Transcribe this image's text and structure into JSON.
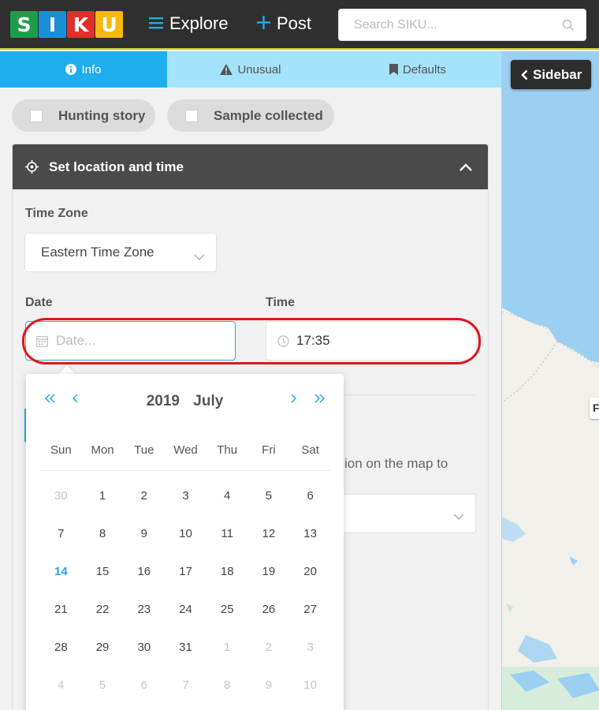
{
  "header": {
    "logo_letters": [
      {
        "letter": "S",
        "color": "#1d9d4a"
      },
      {
        "letter": "I",
        "color": "#1a8fd8"
      },
      {
        "letter": "K",
        "color": "#e0302b"
      },
      {
        "letter": "U",
        "color": "#f5b90f"
      }
    ],
    "explore_label": "Explore",
    "post_label": "Post",
    "search_placeholder": "Search SIKU..."
  },
  "tabs": [
    {
      "label": "Info",
      "icon": "info-icon",
      "active": true
    },
    {
      "label": "Unusual",
      "icon": "warning-icon",
      "active": false
    },
    {
      "label": "Defaults",
      "icon": "bookmark-icon",
      "active": false
    }
  ],
  "toggles": {
    "hunting_story": "Hunting story",
    "sample_collected": "Sample collected"
  },
  "location_section": {
    "title": "Set location and time",
    "timezone_label": "Time Zone",
    "timezone_value": "Eastern Time Zone",
    "date_label": "Date",
    "date_placeholder": "Date...",
    "time_label": "Time",
    "time_value": "17:35",
    "background_text": "ion on the map to"
  },
  "calendar": {
    "year": "2019",
    "month": "July",
    "weekdays": [
      "Sun",
      "Mon",
      "Tue",
      "Wed",
      "Thu",
      "Fri",
      "Sat"
    ],
    "days": [
      {
        "d": "30",
        "muted": true
      },
      {
        "d": "1"
      },
      {
        "d": "2"
      },
      {
        "d": "3"
      },
      {
        "d": "4"
      },
      {
        "d": "5"
      },
      {
        "d": "6"
      },
      {
        "d": "7"
      },
      {
        "d": "8"
      },
      {
        "d": "9"
      },
      {
        "d": "10"
      },
      {
        "d": "11"
      },
      {
        "d": "12"
      },
      {
        "d": "13"
      },
      {
        "d": "14",
        "today": true
      },
      {
        "d": "15"
      },
      {
        "d": "16"
      },
      {
        "d": "17"
      },
      {
        "d": "18"
      },
      {
        "d": "19"
      },
      {
        "d": "20"
      },
      {
        "d": "21"
      },
      {
        "d": "22"
      },
      {
        "d": "23"
      },
      {
        "d": "24"
      },
      {
        "d": "25"
      },
      {
        "d": "26"
      },
      {
        "d": "27"
      },
      {
        "d": "28"
      },
      {
        "d": "29"
      },
      {
        "d": "30"
      },
      {
        "d": "31"
      },
      {
        "d": "1",
        "muted": true
      },
      {
        "d": "2",
        "muted": true
      },
      {
        "d": "3",
        "muted": true
      },
      {
        "d": "4",
        "muted": true
      },
      {
        "d": "5",
        "muted": true
      },
      {
        "d": "6",
        "muted": true
      },
      {
        "d": "7",
        "muted": true
      },
      {
        "d": "8",
        "muted": true
      },
      {
        "d": "9",
        "muted": true
      },
      {
        "d": "10",
        "muted": true
      }
    ]
  },
  "map": {
    "sidebar_button": "Sidebar",
    "marker_label": "F"
  },
  "colors": {
    "accent": "#1eaeee",
    "highlight": "#e01515",
    "header_bg": "#2f2f2f",
    "water": "#9bd0f3"
  }
}
